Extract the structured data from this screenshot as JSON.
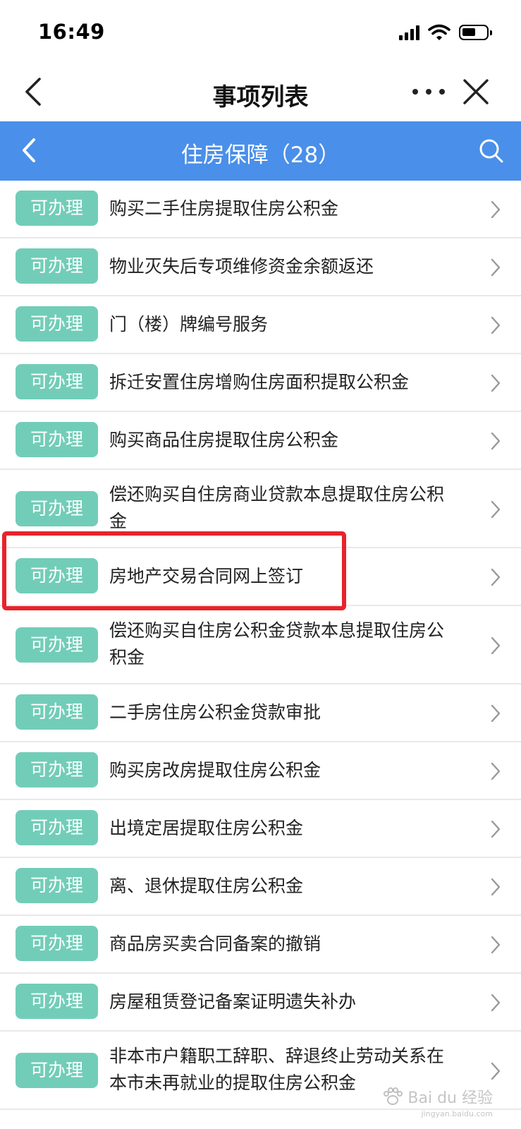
{
  "status_bar": {
    "time": "16:49"
  },
  "nav": {
    "title": "事项列表"
  },
  "category": {
    "title": "住房保障（28）"
  },
  "badge_label": "可办理",
  "items": [
    {
      "label": "购买二手住房提取住房公积金"
    },
    {
      "label": "物业灭失后专项维修资金余额返还"
    },
    {
      "label": "门（楼）牌编号服务"
    },
    {
      "label": "拆迁安置住房增购住房面积提取公积金"
    },
    {
      "label": "购买商品住房提取住房公积金"
    },
    {
      "label": "偿还购买自住房商业贷款本息提取住房公积金"
    },
    {
      "label": "房地产交易合同网上签订"
    },
    {
      "label": "偿还购买自住房公积金贷款本息提取住房公积金"
    },
    {
      "label": "二手房住房公积金贷款审批"
    },
    {
      "label": "购买房改房提取住房公积金"
    },
    {
      "label": "出境定居提取住房公积金"
    },
    {
      "label": "离、退休提取住房公积金"
    },
    {
      "label": "商品房买卖合同备案的撤销"
    },
    {
      "label": "房屋租赁登记备案证明遗失补办"
    },
    {
      "label": "非本市户籍职工辞职、辞退终止劳动关系在本市未再就业的提取住房公积金"
    }
  ],
  "watermark": {
    "text": "Bai du 经验",
    "sub": "jingyan.baidu.com"
  },
  "colors": {
    "header_blue": "#4a8fe9",
    "badge_green": "#72cdb8",
    "highlight_red": "#e8232b"
  },
  "icons": [
    "back-icon",
    "more-icon",
    "close-icon",
    "search-icon",
    "chevron-right-icon",
    "signal-icon",
    "wifi-icon",
    "battery-icon"
  ]
}
